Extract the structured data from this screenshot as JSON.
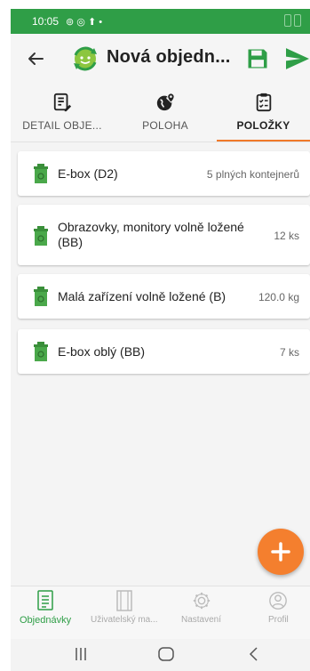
{
  "status_bar": {
    "time": "10:05",
    "left_icons": "⊚ ◎ ⬆ •"
  },
  "toolbar": {
    "title": "Nová objedn..."
  },
  "tabs": [
    {
      "label": "DETAIL OBJE...",
      "icon": "document-edit-icon"
    },
    {
      "label": "POLOHA",
      "icon": "globe-pin-icon"
    },
    {
      "label": "POLOŽKY",
      "icon": "clipboard-check-icon",
      "active": true
    }
  ],
  "items": [
    {
      "name": "E-box (D2)",
      "qty": "5 plných kontejnerů"
    },
    {
      "name": "Obrazovky, monitory volně ložené (BB)",
      "qty": "12 ks"
    },
    {
      "name": "Malá zařízení volně ložené (B)",
      "qty": "120.0 kg"
    },
    {
      "name": "E-box oblý (BB)",
      "qty": "7 ks"
    }
  ],
  "bottom_nav": [
    {
      "label": "Objednávky",
      "active": true
    },
    {
      "label": "Uživatelský ma..."
    },
    {
      "label": "Nastavení"
    },
    {
      "label": "Profil"
    }
  ],
  "colors": {
    "accent_green": "#2f9e47",
    "accent_orange": "#f47f2e"
  }
}
